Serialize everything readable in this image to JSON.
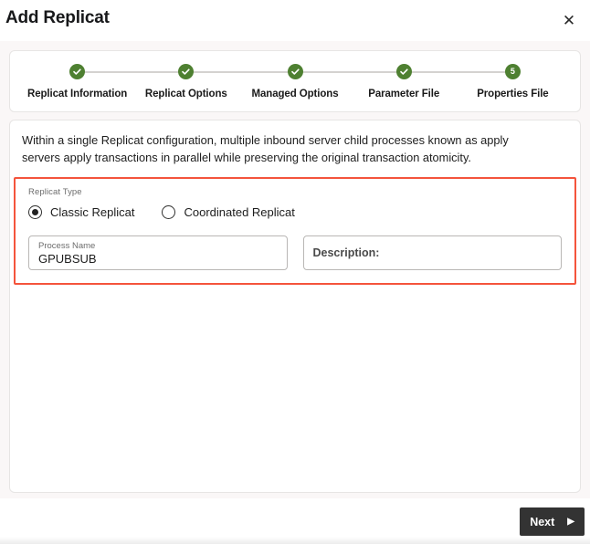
{
  "dialog": {
    "title": "Add Replicat",
    "close_icon": "close-icon",
    "close_glyph": "✕"
  },
  "stepper": {
    "steps": [
      {
        "label": "Replicat Information",
        "state": "complete",
        "number": "1",
        "icon": "check-icon"
      },
      {
        "label": "Replicat Options",
        "state": "complete",
        "number": "2",
        "icon": "check-icon"
      },
      {
        "label": "Managed Options",
        "state": "complete",
        "number": "3",
        "icon": "check-icon"
      },
      {
        "label": "Parameter File",
        "state": "complete",
        "number": "4",
        "icon": "check-icon"
      },
      {
        "label": "Properties File",
        "state": "current",
        "number": "5",
        "icon": "number"
      }
    ],
    "complete_color": "#4e8031",
    "current_color": "#4e8031",
    "connector_color": "#d4d2d0"
  },
  "main": {
    "intro_text": "Within a single Replicat configuration, multiple inbound server child processes known as apply servers apply transactions in parallel while preserving the original transaction atomicity.",
    "highlight_border_color": "#f4543c",
    "replicat_type": {
      "group_label": "Replicat Type",
      "options": [
        {
          "label": "Classic Replicat",
          "selected": true
        },
        {
          "label": "Coordinated Replicat",
          "selected": false
        }
      ]
    },
    "process_name_field": {
      "label": "Process Name",
      "value": "GPUBSUB"
    },
    "description_field": {
      "placeholder": "Description:",
      "value": ""
    }
  },
  "footer": {
    "next_label": "Next",
    "next_arrow_glyph": "▶",
    "next_bg_color": "#333333"
  }
}
